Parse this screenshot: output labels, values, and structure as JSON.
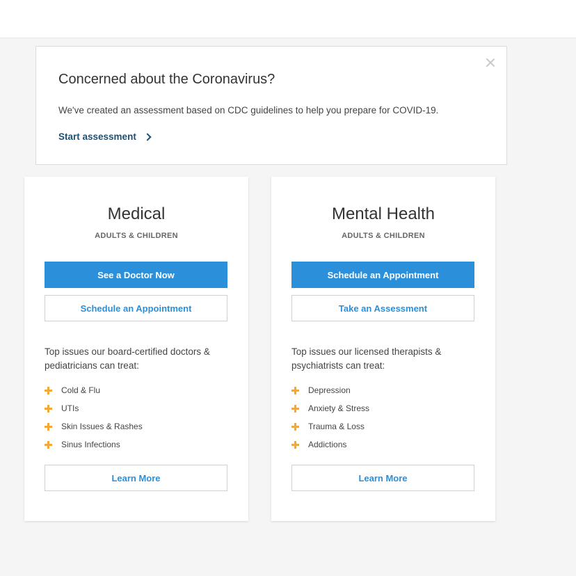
{
  "banner": {
    "title": "Concerned about the Coronavirus?",
    "text": "We've created an assessment based on CDC guidelines to help you prepare for COVID-19.",
    "link_label": "Start assessment",
    "close_icon": "close-icon"
  },
  "cards": [
    {
      "title": "Medical",
      "subtitle": "ADULTS & CHILDREN",
      "primary_button": "See a Doctor Now",
      "secondary_button": "Schedule an Appointment",
      "description": "Top issues our board-certified doctors & pediatricians can treat:",
      "issues": [
        "Cold & Flu",
        "UTIs",
        "Skin Issues & Rashes",
        "Sinus Infections"
      ],
      "learn_more": "Learn More"
    },
    {
      "title": "Mental Health",
      "subtitle": "ADULTS & CHILDREN",
      "primary_button": "Schedule an Appointment",
      "secondary_button": "Take an Assessment",
      "description": "Top issues our licensed therapists & psychiatrists can treat:",
      "issues": [
        "Depression",
        "Anxiety & Stress",
        "Trauma & Loss",
        "Addictions"
      ],
      "learn_more": "Learn More"
    }
  ],
  "colors": {
    "primary": "#2b8fd9",
    "bullet": "#f0a93a",
    "link": "#1f4f72"
  }
}
